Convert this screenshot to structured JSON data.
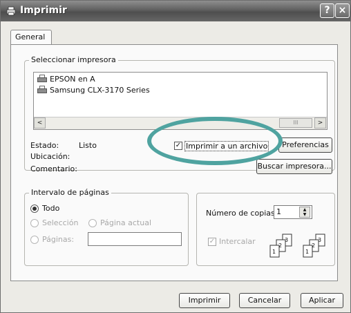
{
  "window": {
    "title": "Imprimir",
    "help_label": "?",
    "close_label": "×"
  },
  "tabs": [
    {
      "label": "General"
    }
  ],
  "printer_select": {
    "group_label": "Seleccionar impresora",
    "printers": [
      {
        "name": "EPSON en A"
      },
      {
        "name": "Samsung CLX-3170 Series"
      }
    ],
    "scroll_left": "<",
    "scroll_right": ">",
    "scroll_thumb": "III"
  },
  "status": {
    "estado_label": "Estado:",
    "estado_value": "Listo",
    "ubicacion_label": "Ubicación:",
    "comentario_label": "Comentario:",
    "print_to_file_label": "Imprimir a un archivo",
    "print_to_file_checked": true,
    "check_mark": "✓",
    "preferences_label": "Preferencias",
    "find_printer_label": "Buscar impresora..."
  },
  "page_range": {
    "group_label": "Intervalo de páginas",
    "all_label": "Todo",
    "selection_label": "Selección",
    "current_page_label": "Página actual",
    "pages_label": "Páginas:",
    "pages_value": ""
  },
  "copies": {
    "label": "Número de copias:",
    "value": "1",
    "collate_label": "Intercalar",
    "collate_checked": true,
    "check_mark": "✓",
    "spin_up": "▲",
    "spin_down": "▼",
    "page_numbers": [
      "1",
      "2",
      "3"
    ]
  },
  "footer": {
    "print_label": "Imprimir",
    "cancel_label": "Cancelar",
    "apply_label": "Aplicar"
  }
}
